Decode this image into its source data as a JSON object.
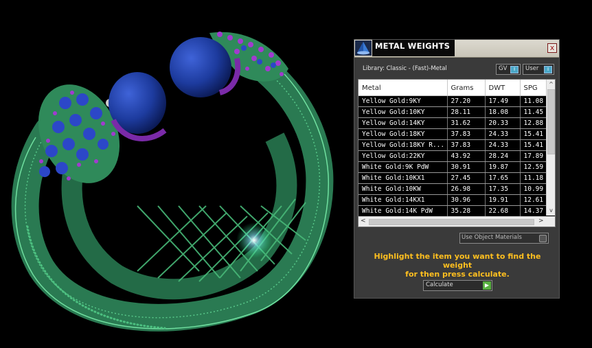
{
  "viewport": {
    "model": "bangle-ring-render",
    "colors": {
      "background": "#000000",
      "metal": "#2f8a5a",
      "metal_edge": "#70e0a0",
      "pearl": "#1d3b9e",
      "gem_blue": "#2c47c8",
      "gem_purple": "#a23ad0"
    }
  },
  "panel": {
    "title": "METAL WEIGHTS",
    "logo_icon": "triangle-cone-logo",
    "close_label": "x",
    "library_label": "Library: Classic - (Fast)-Metal",
    "gv_toggle": {
      "label": "GV",
      "knob": "I"
    },
    "user_toggle": {
      "label": "User",
      "knob": "I"
    },
    "table": {
      "columns": [
        "Metal",
        "Grams",
        "DWT",
        "SPG"
      ],
      "rows": [
        [
          "Yellow Gold:9KY",
          "27.20",
          "17.49",
          "11.08"
        ],
        [
          "Yellow Gold:10KY",
          "28.11",
          "18.08",
          "11.45"
        ],
        [
          "Yellow Gold:14KY",
          "31.62",
          "20.33",
          "12.88"
        ],
        [
          "Yellow Gold:18KY",
          "37.83",
          "24.33",
          "15.41"
        ],
        [
          "Yellow Gold:18KY R...",
          "37.83",
          "24.33",
          "15.41"
        ],
        [
          "Yellow Gold:22KY",
          "43.92",
          "28.24",
          "17.89"
        ],
        [
          "White Gold:9K PdW",
          "30.91",
          "19.87",
          "12.59"
        ],
        [
          "White Gold:10KX1",
          "27.45",
          "17.65",
          "11.18"
        ],
        [
          "White Gold:10KW",
          "26.98",
          "17.35",
          "10.99"
        ],
        [
          "White Gold:14KX1",
          "30.96",
          "19.91",
          "12.61"
        ],
        [
          "White Gold:14K PdW",
          "35.28",
          "22.68",
          "14.37"
        ]
      ]
    },
    "scroll": {
      "up": "^",
      "down": "v",
      "left": "<",
      "right": ">"
    },
    "use_object_materials_label": "Use Object Materials",
    "hint_line1": "Highlight the item you want to find the weight",
    "hint_line2": "for then press calculate.",
    "calculate_label": "Calculate",
    "calculate_icon": "play-arrow-icon",
    "accent_color": "#ffbf1f"
  }
}
